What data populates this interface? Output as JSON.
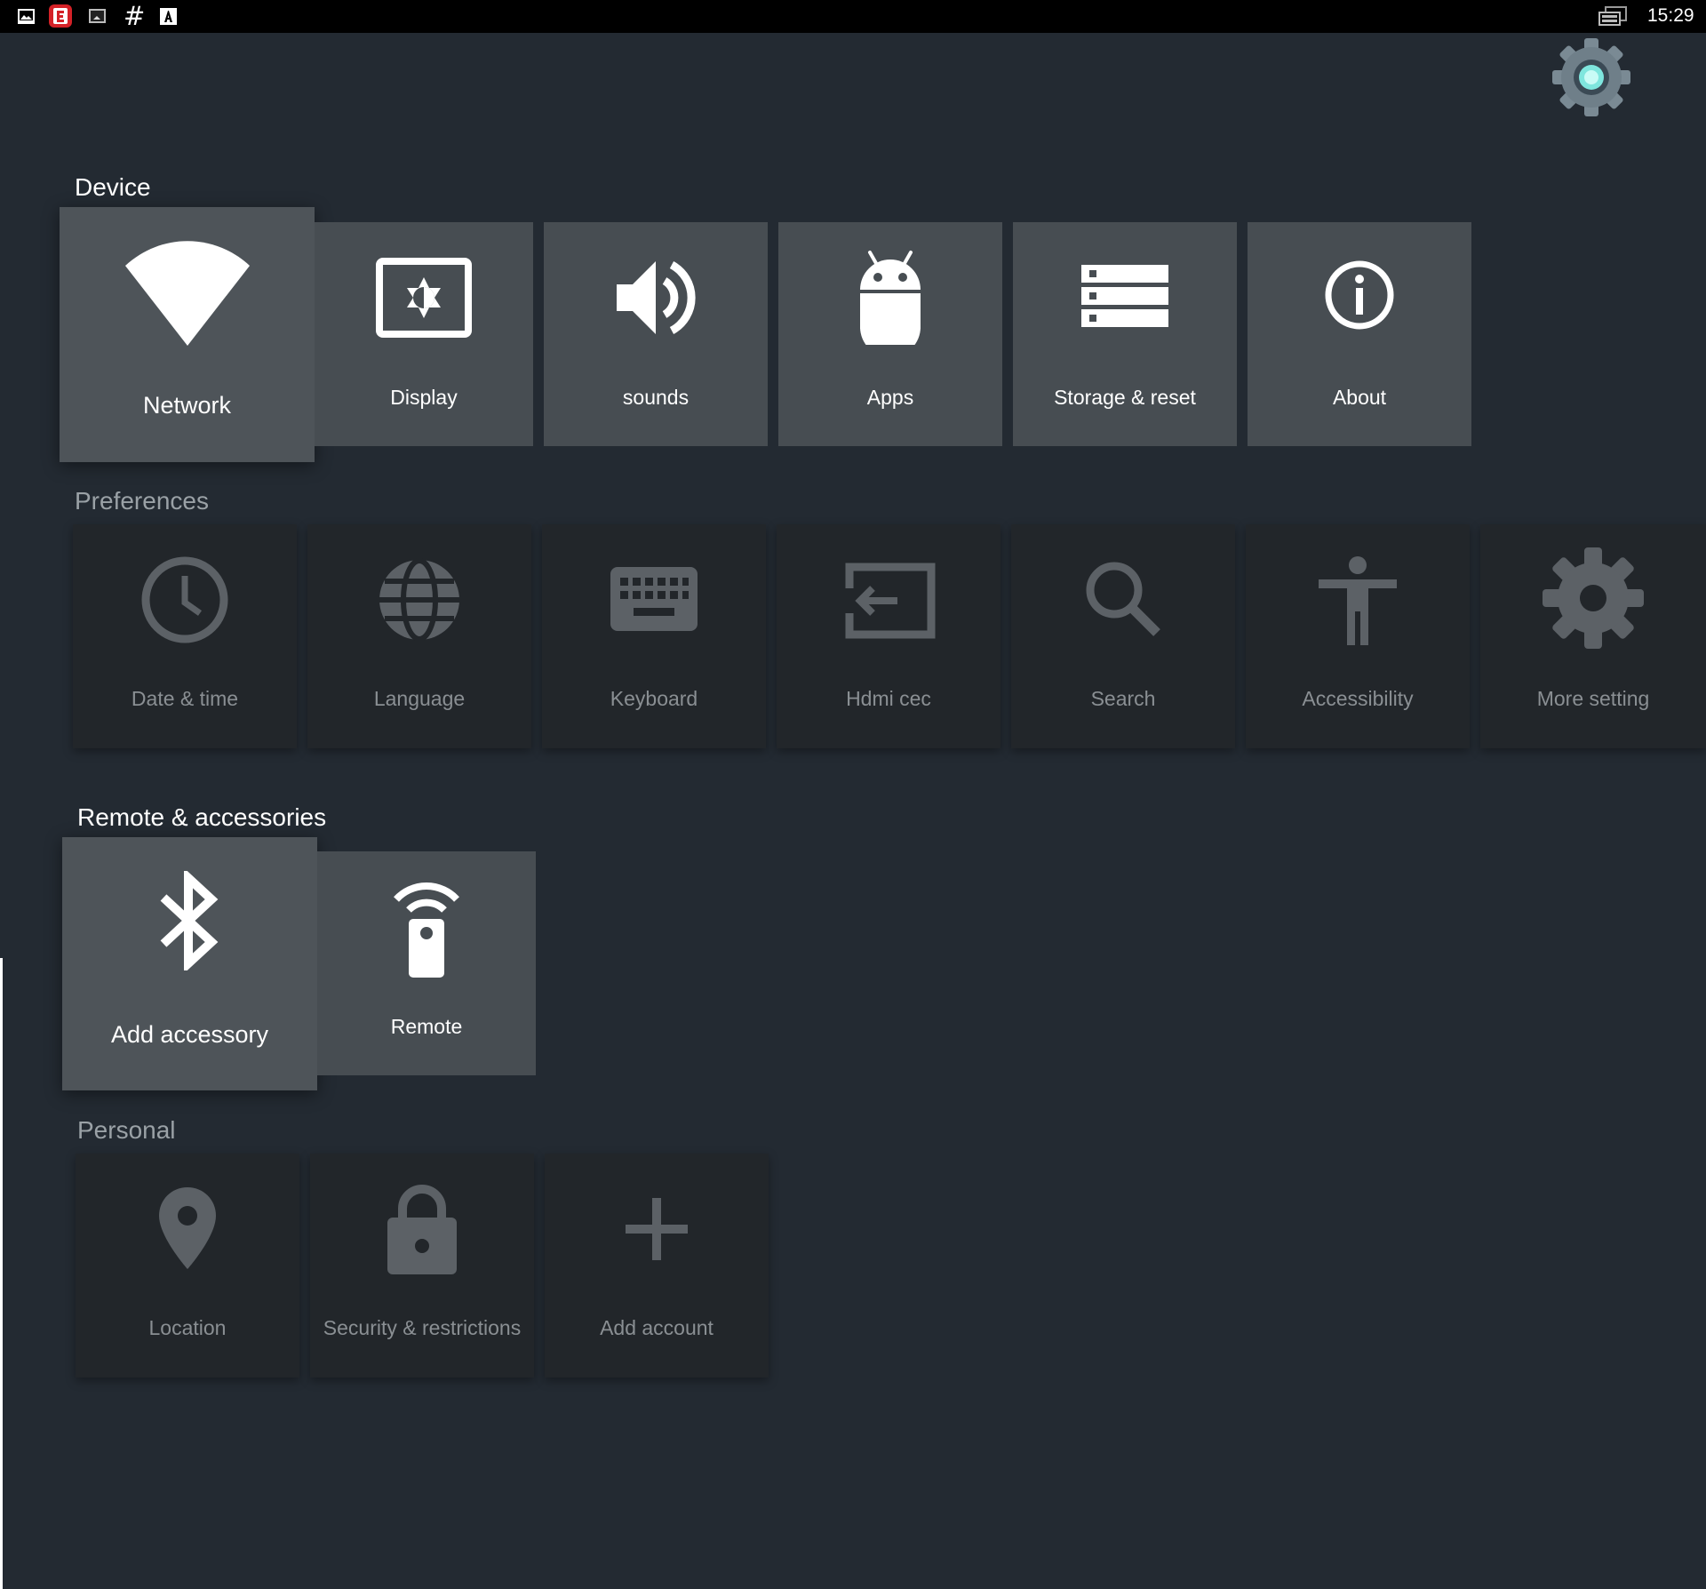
{
  "status_bar": {
    "time": "15:29",
    "notification_icons": [
      "gallery-icon",
      "e-app-icon",
      "cast-icon",
      "hash-icon",
      "a-app-icon"
    ],
    "hash_glyph": "#",
    "right_icons": [
      "connected-screens-icon"
    ]
  },
  "sections": {
    "device": {
      "title": "Device",
      "items": [
        {
          "label": "Network",
          "icon": "wifi-icon",
          "focused": true
        },
        {
          "label": "Display",
          "icon": "display-icon"
        },
        {
          "label": "sounds",
          "icon": "speaker-icon"
        },
        {
          "label": "Apps",
          "icon": "android-icon"
        },
        {
          "label": "Storage & reset",
          "icon": "storage-icon"
        },
        {
          "label": "About",
          "icon": "info-icon"
        }
      ]
    },
    "preferences": {
      "title": "Preferences",
      "items": [
        {
          "label": "Date & time",
          "icon": "clock-icon"
        },
        {
          "label": "Language",
          "icon": "globe-icon"
        },
        {
          "label": "Keyboard",
          "icon": "keyboard-icon"
        },
        {
          "label": "Hdmi cec",
          "icon": "input-icon"
        },
        {
          "label": "Search",
          "icon": "search-icon"
        },
        {
          "label": "Accessibility",
          "icon": "accessibility-icon"
        },
        {
          "label": "More setting",
          "icon": "gear-icon"
        }
      ]
    },
    "remote": {
      "title": "Remote & accessories",
      "items": [
        {
          "label": "Add accessory",
          "icon": "bluetooth-icon",
          "focused": true
        },
        {
          "label": "Remote",
          "icon": "remote-icon"
        }
      ]
    },
    "personal": {
      "title": "Personal",
      "items": [
        {
          "label": "Location",
          "icon": "location-pin-icon"
        },
        {
          "label": "Security & restrictions",
          "icon": "lock-icon"
        },
        {
          "label": "Add account",
          "icon": "plus-icon"
        }
      ]
    }
  },
  "colors": {
    "background": "#232a32",
    "device_tile": "#474d52",
    "pref_tile": "#22262a",
    "accent": "#7fe6de"
  }
}
